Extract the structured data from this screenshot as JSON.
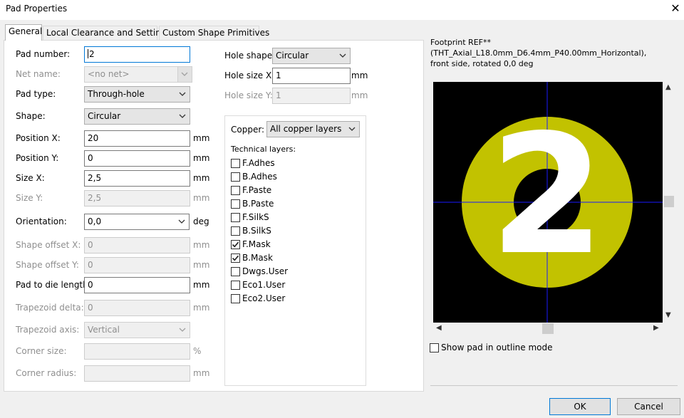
{
  "window": {
    "title": "Pad Properties"
  },
  "tabs": [
    {
      "label": "General"
    },
    {
      "label": "Local Clearance and Settings"
    },
    {
      "label": "Custom Shape Primitives"
    }
  ],
  "general": {
    "pad_number": {
      "label": "Pad number:",
      "value": "2"
    },
    "net_name": {
      "label": "Net name:",
      "value": "<no net>"
    },
    "pad_type": {
      "label": "Pad type:",
      "value": "Through-hole"
    },
    "shape": {
      "label": "Shape:",
      "value": "Circular"
    },
    "position_x": {
      "label": "Position X:",
      "value": "20",
      "unit": "mm"
    },
    "position_y": {
      "label": "Position Y:",
      "value": "0",
      "unit": "mm"
    },
    "size_x": {
      "label": "Size X:",
      "value": "2,5",
      "unit": "mm"
    },
    "size_y": {
      "label": "Size Y:",
      "value": "2,5",
      "unit": "mm"
    },
    "orientation": {
      "label": "Orientation:",
      "value": "0,0",
      "unit": "deg"
    },
    "shape_offset_x": {
      "label": "Shape offset X:",
      "value": "0",
      "unit": "mm"
    },
    "shape_offset_y": {
      "label": "Shape offset Y:",
      "value": "0",
      "unit": "mm"
    },
    "pad_to_die": {
      "label": "Pad to die length:",
      "value": "0",
      "unit": "mm"
    },
    "trapezoid_delta": {
      "label": "Trapezoid delta:",
      "value": "0",
      "unit": "mm"
    },
    "trapezoid_axis": {
      "label": "Trapezoid axis:",
      "value": "Vertical"
    },
    "corner_size": {
      "label": "Corner size:",
      "value": "",
      "unit": "%"
    },
    "corner_radius": {
      "label": "Corner radius:",
      "value": "",
      "unit": "mm"
    }
  },
  "hole": {
    "shape": {
      "label": "Hole shape:",
      "value": "Circular"
    },
    "size_x": {
      "label": "Hole size X:",
      "value": "1",
      "unit": "mm"
    },
    "size_y": {
      "label": "Hole size Y:",
      "value": "1",
      "unit": "mm"
    }
  },
  "layers": {
    "copper_label": "Copper:",
    "copper_value": "All copper layers",
    "technical_label": "Technical layers:",
    "items": [
      {
        "name": "F.Adhes",
        "checked": false
      },
      {
        "name": "B.Adhes",
        "checked": false
      },
      {
        "name": "F.Paste",
        "checked": false
      },
      {
        "name": "B.Paste",
        "checked": false
      },
      {
        "name": "F.SilkS",
        "checked": false
      },
      {
        "name": "B.SilkS",
        "checked": false
      },
      {
        "name": "F.Mask",
        "checked": true
      },
      {
        "name": "B.Mask",
        "checked": true
      },
      {
        "name": "Dwgs.User",
        "checked": false
      },
      {
        "name": "Eco1.User",
        "checked": false
      },
      {
        "name": "Eco2.User",
        "checked": false
      }
    ]
  },
  "preview": {
    "caption_line1": "Footprint REF** (THT_Axial_L18.0mm_D6.4mm_P40.00mm_Horizontal),",
    "caption_line2": "front side, rotated 0,0 deg",
    "pad_label": "2",
    "outline_mode_label": "Show pad in outline mode",
    "outline_mode_checked": false,
    "colors": {
      "background": "#000000",
      "pad": "#c2c200",
      "crosshair": "#1a1aff",
      "label": "#ffffff"
    }
  },
  "buttons": {
    "ok": "OK",
    "cancel": "Cancel"
  }
}
